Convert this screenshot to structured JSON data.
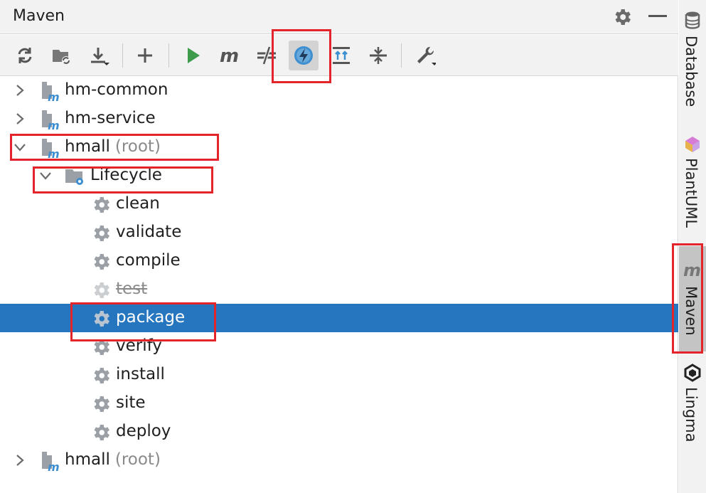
{
  "panel": {
    "title": "Maven"
  },
  "toolbar": {
    "buttons": [
      {
        "name": "reload-all-projects",
        "icon": "refresh-icon"
      },
      {
        "name": "generate-sources",
        "icon": "folder-refresh-icon"
      },
      {
        "name": "download-sources",
        "icon": "download-icon"
      },
      {
        "name": "add-maven-project",
        "icon": "plus-icon"
      },
      {
        "name": "run-maven-build",
        "icon": "play-icon"
      },
      {
        "name": "execute-maven-goal",
        "icon": "maven-m-icon"
      },
      {
        "name": "toggle-offline-mode",
        "icon": "offline-icon"
      },
      {
        "name": "skip-tests-mode",
        "icon": "lightning-icon",
        "active": true
      },
      {
        "name": "show-dependencies",
        "icon": "dependencies-icon"
      },
      {
        "name": "collapse-all",
        "icon": "collapse-icon"
      },
      {
        "name": "maven-settings",
        "icon": "wrench-icon"
      }
    ]
  },
  "tree": {
    "nodes": [
      {
        "label": "hm-common",
        "suffix": "",
        "expanded": false
      },
      {
        "label": "hm-service",
        "suffix": "",
        "expanded": false
      },
      {
        "label": "hmall",
        "suffix": "(root)",
        "expanded": true
      },
      {
        "label": "Lifecycle",
        "expanded": true
      },
      {
        "goals": [
          "clean",
          "validate",
          "compile",
          "test",
          "package",
          "verify",
          "install",
          "site",
          "deploy"
        ]
      },
      {
        "label": "hmall",
        "suffix": "(root)",
        "expanded": false
      }
    ],
    "selected_goal": "package",
    "skipped_goal": "test"
  },
  "sidebar": {
    "tabs": [
      {
        "label": "Database",
        "icon": "database-icon",
        "active": false
      },
      {
        "label": "PlantUML",
        "icon": "plantuml-icon",
        "active": false
      },
      {
        "label": "Maven",
        "icon": "maven-m-icon",
        "active": true
      },
      {
        "label": "Lingma",
        "icon": "lingma-icon",
        "active": false
      }
    ]
  },
  "colors": {
    "selection": "#2675bf",
    "highlight_box": "#e3242b",
    "header_bg": "#f2f2f2",
    "maven_blue": "#3d8fd1",
    "run_green": "#3d9b4b"
  }
}
